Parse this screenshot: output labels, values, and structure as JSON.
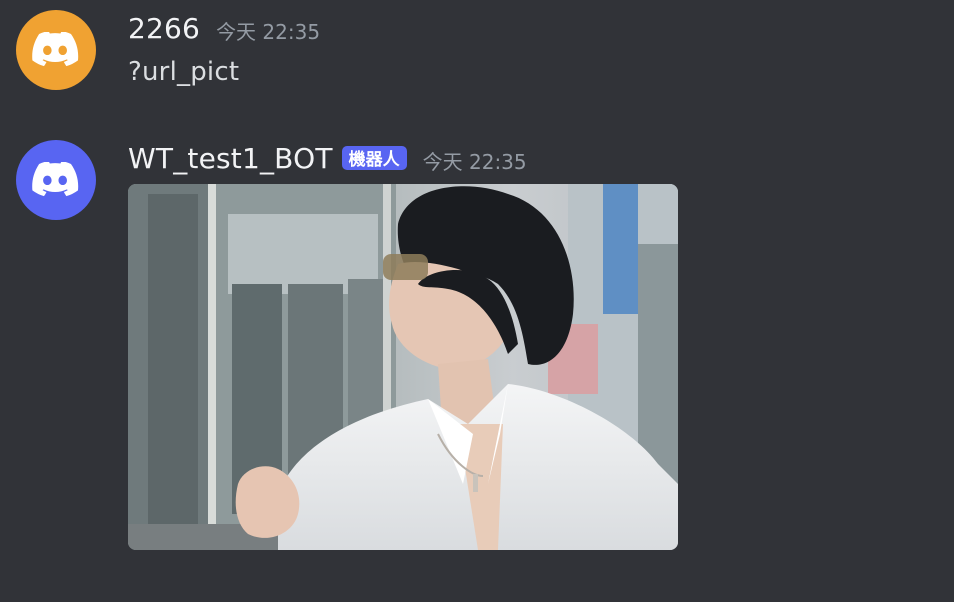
{
  "messages": [
    {
      "username": "2266",
      "timestamp": "今天 22:35",
      "content": "?url_pict",
      "avatar": {
        "icon": "discord-logo-icon",
        "color": "#f0a232"
      }
    },
    {
      "username": "WT_test1_BOT",
      "badge": "機器人",
      "timestamp": "今天 22:35",
      "attachment": {
        "type": "image",
        "subject": "photo"
      },
      "avatar": {
        "icon": "discord-logo-icon",
        "color": "#5865f2"
      }
    }
  ],
  "colors": {
    "background": "#313338",
    "username": "#f2f3f5",
    "timestamp": "#949ba4",
    "text": "#dbdee1",
    "bot_badge": "#5865f2"
  }
}
